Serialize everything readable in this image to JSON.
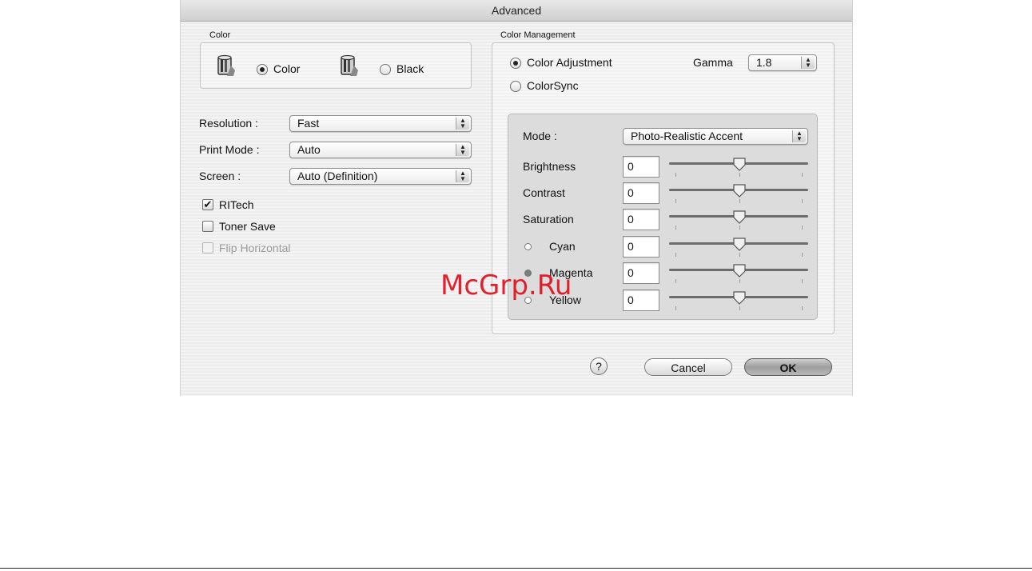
{
  "window": {
    "title": "Advanced"
  },
  "color_group": {
    "label": "Color",
    "options": [
      {
        "label": "Color",
        "selected": true,
        "icon": "color-printer-icon"
      },
      {
        "label": "Black",
        "selected": false,
        "icon": "black-printer-icon"
      }
    ]
  },
  "settings": {
    "resolution": {
      "label": "Resolution :",
      "value": "Fast"
    },
    "print_mode": {
      "label": "Print Mode :",
      "value": "Auto"
    },
    "screen": {
      "label": "Screen :",
      "value": "Auto (Definition)"
    }
  },
  "checkboxes": [
    {
      "label": "RITech",
      "checked": true,
      "enabled": true
    },
    {
      "label": "Toner Save",
      "checked": false,
      "enabled": true
    },
    {
      "label": "Flip Horizontal",
      "checked": false,
      "enabled": false
    }
  ],
  "color_management": {
    "label": "Color Management",
    "color_adjustment": {
      "label": "Color Adjustment",
      "selected": true
    },
    "colorsync": {
      "label": "ColorSync",
      "selected": false
    },
    "gamma": {
      "label": "Gamma",
      "value": "1.8"
    },
    "mode": {
      "label": "Mode :",
      "value": "Photo-Realistic Accent"
    },
    "adjustments": [
      {
        "label": "Brightness",
        "value": "0"
      },
      {
        "label": "Contrast",
        "value": "0"
      },
      {
        "label": "Saturation",
        "value": "0"
      },
      {
        "label": "Cyan",
        "value": "0",
        "radio": true,
        "selected": false
      },
      {
        "label": "Magenta",
        "value": "0",
        "radio": true,
        "selected": true
      },
      {
        "label": "Yellow",
        "value": "0",
        "radio": true,
        "selected": false
      }
    ]
  },
  "buttons": {
    "help": "?",
    "cancel": "Cancel",
    "ok": "OK"
  },
  "watermark": "McGrp.Ru",
  "colors": {
    "watermark": "#e1101e",
    "dialog_bg": "#ececec"
  }
}
